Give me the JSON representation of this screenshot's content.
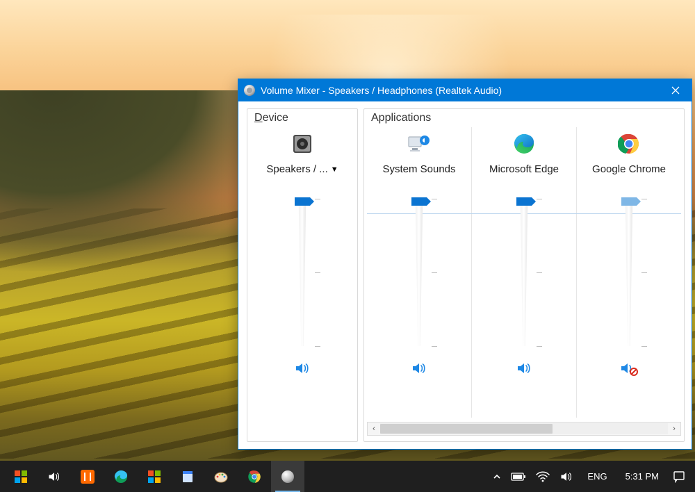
{
  "window": {
    "title": "Volume Mixer - Speakers / Headphones (Realtek Audio)"
  },
  "groups": {
    "device_header": "evice",
    "device_header_prefix": "D",
    "apps_header": "Applications"
  },
  "channels": {
    "device": {
      "label": "Speakers / ...",
      "level": 100,
      "muted": false,
      "icon": "speaker-device-icon"
    },
    "apps": [
      {
        "label": "System Sounds",
        "level": 100,
        "muted": false,
        "icon": "system-sounds-icon"
      },
      {
        "label": "Microsoft Edge",
        "level": 100,
        "muted": false,
        "icon": "edge-icon"
      },
      {
        "label": "Google Chrome",
        "level": 100,
        "muted": true,
        "icon": "chrome-icon"
      }
    ]
  },
  "taskbar": {
    "language": "ENG",
    "clock": "5:31 PM"
  },
  "colors": {
    "accent": "#0078d7",
    "thumb": "#0b74d1"
  }
}
